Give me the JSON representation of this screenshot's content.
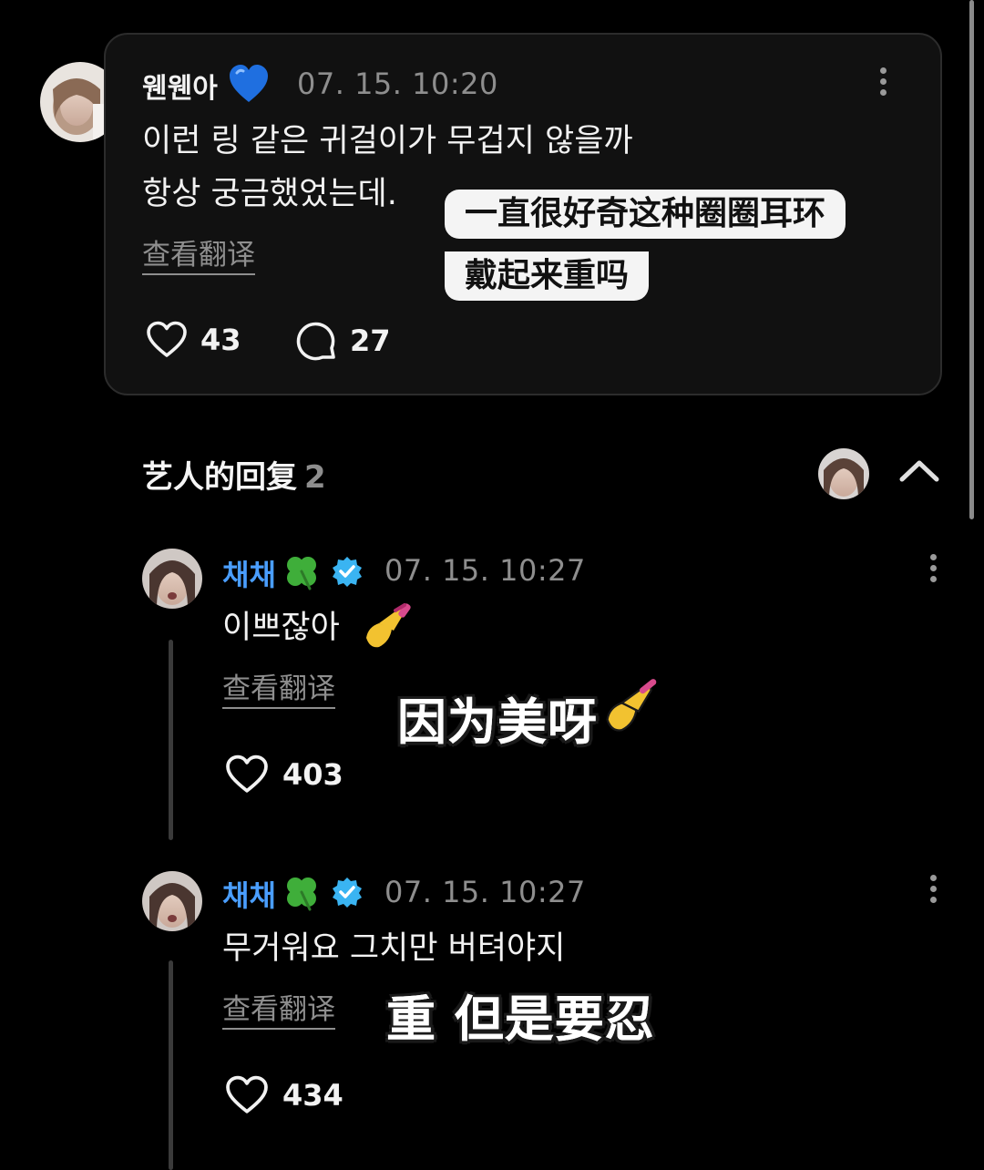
{
  "post": {
    "author": "웬웬아",
    "time": "07. 15. 10:20",
    "lines": [
      "이런 링 같은 귀걸이가 무겁지 않을까",
      "항상 궁금했었는데."
    ],
    "translate_link": "查看翻译",
    "likes": "43",
    "comments": "27",
    "overlay_lines": [
      "一直很好奇这种圈圈耳环",
      "戴起来重吗"
    ]
  },
  "replies_header": {
    "title": "艺人的回复",
    "count": "2"
  },
  "replies": [
    {
      "author": "채채",
      "time": "07. 15. 10:27",
      "text": "이쁘잖아",
      "translate_link": "查看翻译",
      "likes": "403",
      "sticker": "因为美呀"
    },
    {
      "author": "채채",
      "time": "07. 15. 10:27",
      "text": "무거워요 그치만 버텨야지",
      "translate_link": "查看翻译",
      "likes": "434",
      "sticker": "重 但是要忍"
    }
  ],
  "colors": {
    "background": "#000000",
    "card": "#111111",
    "verified": "#3ab4f2",
    "name_blue": "#4a9eff",
    "muted": "#8e8e8e"
  },
  "icons": [
    "blue-heart-icon",
    "clover-icon",
    "verified-badge-icon",
    "heart-icon",
    "comment-icon",
    "kebab-menu-icon",
    "chevron-up-icon",
    "nail-polish-icon"
  ]
}
